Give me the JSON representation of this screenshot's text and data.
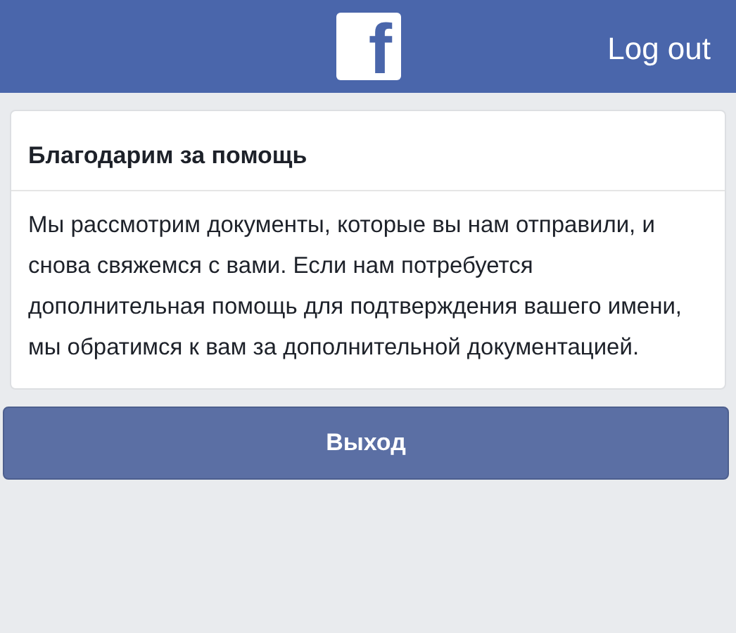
{
  "header": {
    "logo": "f",
    "logout": "Log out"
  },
  "card": {
    "title": "Благодарим за помощь",
    "body": "Мы рассмотрим документы, которые вы нам отправили, и снова свяжемся с вами. Если нам потребуется дополнительная помощь для подтверждения вашего имени, мы обратимся к вам за дополнительной документацией."
  },
  "button": "Выход"
}
